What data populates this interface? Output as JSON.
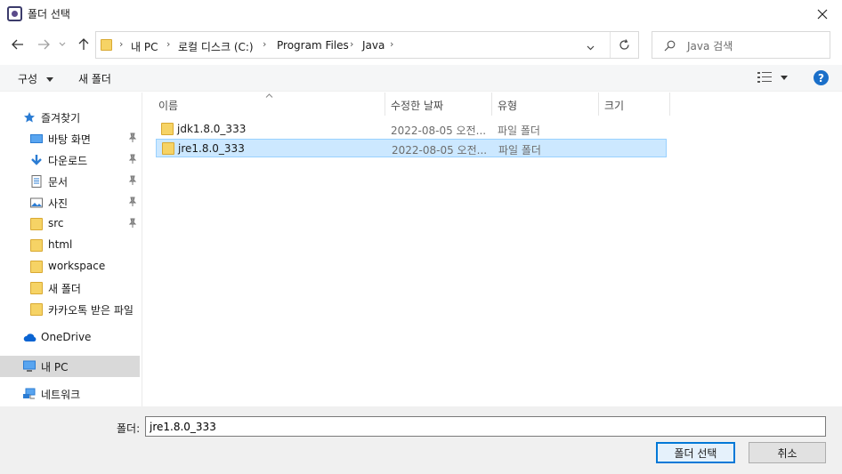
{
  "window": {
    "title": "폴더 선택"
  },
  "address": {
    "breadcrumbs": [
      "내 PC",
      "로컬 디스크 (C:)",
      "Program Files",
      "Java"
    ]
  },
  "search": {
    "placeholder": "Java 검색"
  },
  "toolbar": {
    "organize_label": "구성",
    "new_folder_label": "새 폴더"
  },
  "nav": {
    "quick_access": "즐겨찾기",
    "items": [
      {
        "label": "바탕 화면",
        "icon": "desktop-icon",
        "pinned": true
      },
      {
        "label": "다운로드",
        "icon": "download-icon",
        "pinned": true
      },
      {
        "label": "문서",
        "icon": "document-icon",
        "pinned": true
      },
      {
        "label": "사진",
        "icon": "picture-icon",
        "pinned": true
      },
      {
        "label": "src",
        "icon": "folder-icon",
        "pinned": true
      },
      {
        "label": "html",
        "icon": "folder-icon",
        "pinned": false
      },
      {
        "label": "workspace",
        "icon": "folder-icon",
        "pinned": false
      },
      {
        "label": "새 폴더",
        "icon": "folder-icon",
        "pinned": false
      },
      {
        "label": "카카오톡 받은 파일",
        "icon": "folder-icon",
        "pinned": false
      }
    ],
    "onedrive": "OneDrive",
    "this_pc": "내 PC",
    "network": "네트워크"
  },
  "columns": {
    "name": "이름",
    "modified": "수정한 날짜",
    "type": "유형",
    "size": "크기"
  },
  "files": [
    {
      "name": "jdk1.8.0_333",
      "modified": "2022-08-05 오전...",
      "type": "파일 폴더",
      "selected": false
    },
    {
      "name": "jre1.8.0_333",
      "modified": "2022-08-05 오전...",
      "type": "파일 폴더",
      "selected": true
    }
  ],
  "bottom": {
    "folder_label": "폴더:",
    "folder_value": "jre1.8.0_333",
    "select_label": "폴더 선택",
    "cancel_label": "취소"
  },
  "colors": {
    "accent": "#0078d7",
    "selection": "#cce8ff",
    "folder": "#f6d365"
  }
}
